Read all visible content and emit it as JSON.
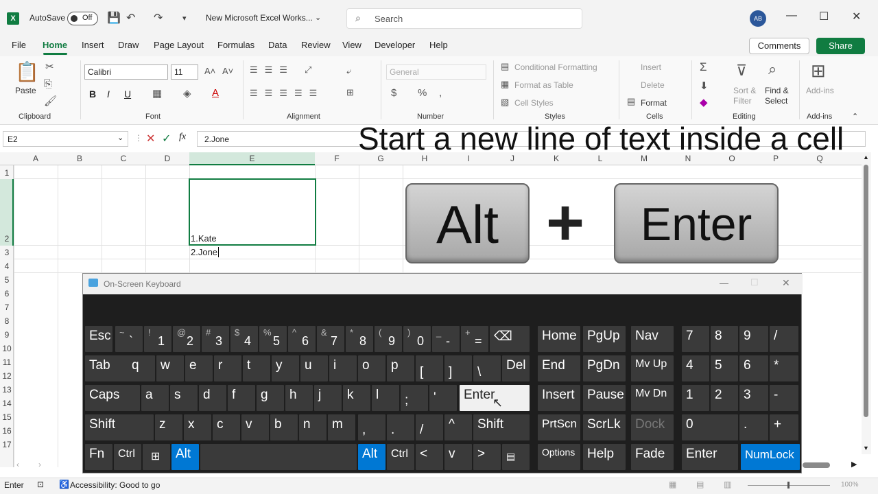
{
  "titlebar": {
    "autosave_label": "AutoSave",
    "autosave_state": "Off",
    "doc_title": "New Microsoft Excel Works...",
    "search_placeholder": "Search",
    "user_initials": "AB"
  },
  "menu": {
    "tabs": [
      "File",
      "Home",
      "Insert",
      "Draw",
      "Page Layout",
      "Formulas",
      "Data",
      "Review",
      "View",
      "Developer",
      "Help"
    ],
    "comments": "Comments",
    "share": "Share"
  },
  "ribbon": {
    "clipboard": {
      "paste": "Paste",
      "label": "Clipboard"
    },
    "font": {
      "name": "Calibri",
      "size": "11",
      "label": "Font",
      "bold": "B",
      "italic": "I",
      "underline": "U"
    },
    "alignment": {
      "label": "Alignment"
    },
    "number": {
      "format": "General",
      "label": "Number",
      "currency": "$",
      "percent": "%"
    },
    "styles": {
      "cond": "Conditional Formatting",
      "table": "Format as Table",
      "cell": "Cell Styles",
      "label": "Styles"
    },
    "cells": {
      "insert": "Insert",
      "delete": "Delete",
      "format": "Format",
      "label": "Cells"
    },
    "editing": {
      "sort": "Sort & Filter",
      "sort1": "Sort &",
      "sort2": "Filter",
      "find1": "Find &",
      "find2": "Select",
      "label": "Editing"
    },
    "addins": {
      "btn": "Add-ins",
      "label": "Add-ins"
    }
  },
  "formula": {
    "cell_ref": "E2",
    "fx": "fx",
    "content": "2.Jone"
  },
  "grid": {
    "columns": [
      "A",
      "B",
      "C",
      "D",
      "E",
      "F",
      "G",
      "H",
      "I",
      "J",
      "K",
      "L",
      "M",
      "N",
      "O",
      "P",
      "Q"
    ],
    "rows": [
      "1",
      "2",
      "3",
      "4",
      "5",
      "6",
      "7",
      "8",
      "9",
      "10",
      "11",
      "12",
      "13",
      "14",
      "15",
      "16",
      "17"
    ],
    "cell_e2_line1": "1.Kate",
    "cell_e2_line2": "2.Jone"
  },
  "overlay": {
    "headline": "Start a new line of text inside a cell",
    "key1": "Alt",
    "plus": "+",
    "key2": "Enter"
  },
  "osk": {
    "title": "On-Screen Keyboard",
    "row1": [
      [
        "Esc",
        ""
      ],
      [
        "`",
        "~"
      ],
      [
        "1",
        "!"
      ],
      [
        "2",
        "@"
      ],
      [
        "3",
        "#"
      ],
      [
        "4",
        "$"
      ],
      [
        "5",
        "%"
      ],
      [
        "6",
        "^"
      ],
      [
        "7",
        "&"
      ],
      [
        "8",
        "*"
      ],
      [
        "9",
        "("
      ],
      [
        "0",
        ")"
      ],
      [
        "-",
        "_"
      ],
      [
        "=",
        "+"
      ]
    ],
    "row2": [
      "Tab",
      "q",
      "w",
      "e",
      "r",
      "t",
      "y",
      "u",
      "i",
      "o",
      "p",
      "[",
      "]",
      "\\",
      "Del"
    ],
    "row3": [
      "Caps",
      "a",
      "s",
      "d",
      "f",
      "g",
      "h",
      "j",
      "k",
      "l",
      ";",
      "'",
      "Enter"
    ],
    "row4": [
      "Shift",
      "z",
      "x",
      "c",
      "v",
      "b",
      "n",
      "m",
      ",",
      ".",
      "/",
      "^",
      "Shift"
    ],
    "row5": [
      "Fn",
      "Ctrl",
      "⊞",
      "Alt",
      "",
      "Alt",
      "Ctrl",
      "<",
      "v",
      ">",
      "▤"
    ],
    "nav": [
      "Home",
      "PgUp",
      "Nav",
      "End",
      "PgDn",
      "Mv Up",
      "Insert",
      "Pause",
      "Mv Dn",
      "PrtScn",
      "ScrLk",
      "Dock",
      "Options",
      "Help",
      "Fade"
    ],
    "numpad": [
      "7",
      "8",
      "9",
      "/",
      "4",
      "5",
      "6",
      "*",
      "1",
      "2",
      "3",
      "-",
      "0",
      ".",
      "+",
      "Enter",
      "NumLock"
    ]
  },
  "status": {
    "mode": "Enter",
    "accessibility": "Accessibility: Good to go",
    "zoom": "100%"
  },
  "colors": {
    "excel_green": "#107c41",
    "osk_bg": "#1e1e1e",
    "osk_key": "#3a3a3a",
    "osk_active": "#0078d4"
  }
}
